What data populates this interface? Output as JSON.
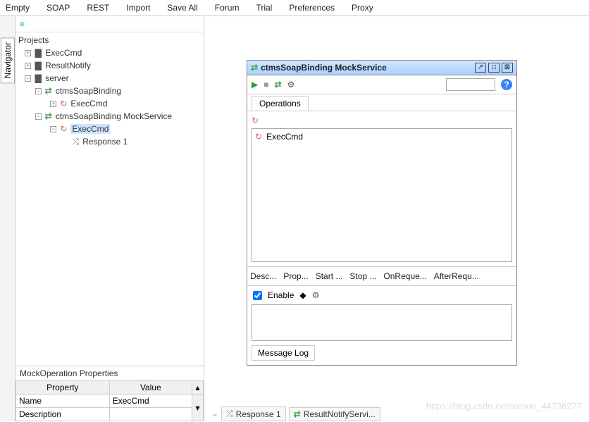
{
  "menu": [
    "Empty",
    "SOAP",
    "REST",
    "Import",
    "Save All",
    "Forum",
    "Trial",
    "Preferences",
    "Proxy"
  ],
  "navigator_label": "Navigator",
  "tree": {
    "root": "Projects",
    "items": {
      "execcmd": "ExecCmd",
      "resultnotify": "ResultNotify",
      "server": "server",
      "binding": "ctmsSoapBinding",
      "binding_exec": "ExecCmd",
      "mockservice": "ctmsSoapBinding MockService",
      "mock_exec": "ExecCmd",
      "response1": "Response 1"
    }
  },
  "props": {
    "title": "MockOperation Properties",
    "cols": [
      "Property",
      "Value"
    ],
    "rows": [
      {
        "k": "Name",
        "v": "ExecCmd"
      },
      {
        "k": "Description",
        "v": ""
      }
    ]
  },
  "mock": {
    "title": "ctmsSoapBinding MockService",
    "tab": "Operations",
    "op": "ExecCmd",
    "buttons": [
      "Desc...",
      "Prop...",
      "Start ...",
      "Stop ...",
      "OnReque...",
      "AfterRequ..."
    ],
    "enable": "Enable",
    "msglog": "Message Log"
  },
  "bottom": {
    "dash": "--",
    "resp": "Response 1",
    "rn": "ResultNotifyServi..."
  },
  "watermark": "https://blog.csdn.net/weixin_44736277"
}
